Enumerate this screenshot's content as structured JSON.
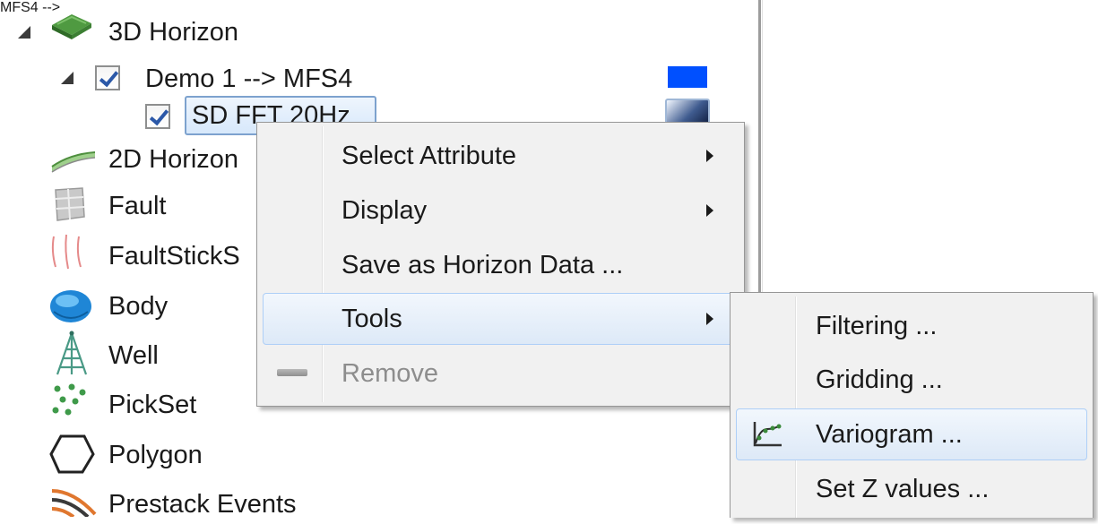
{
  "tree": {
    "items": [
      {
        "label": "3D Horizon",
        "icon": "horizon-3d-icon"
      },
      {
        "label": "Demo 1 --> MFS4",
        "checked": true,
        "swatch_color": "#0050ff"
      },
      {
        "label": "SD FFT 20Hz",
        "checked": true,
        "selected": true
      },
      {
        "label": "2D Horizon",
        "icon": "horizon-2d-icon"
      },
      {
        "label": "Fault",
        "icon": "fault-icon"
      },
      {
        "label": "FaultStickS",
        "icon": "faultstick-icon"
      },
      {
        "label": "Body",
        "icon": "body-icon"
      },
      {
        "label": "Well",
        "icon": "well-icon"
      },
      {
        "label": "PickSet",
        "icon": "pickset-icon"
      },
      {
        "label": "Polygon",
        "icon": "polygon-icon"
      },
      {
        "label": "Prestack Events",
        "icon": "prestack-events-icon"
      }
    ]
  },
  "context_menu": {
    "items": [
      {
        "label": "Select Attribute",
        "submenu": true
      },
      {
        "label": "Display",
        "submenu": true
      },
      {
        "label": "Save as Horizon Data ...",
        "submenu": false
      },
      {
        "label": "Tools",
        "submenu": true,
        "highlighted": true
      },
      {
        "label": "Remove",
        "submenu": false,
        "disabled": true,
        "icon": "remove-icon"
      }
    ]
  },
  "tools_submenu": {
    "items": [
      {
        "label": "Filtering ..."
      },
      {
        "label": "Gridding ..."
      },
      {
        "label": "Variogram ...",
        "highlighted": true,
        "icon": "variogram-icon"
      },
      {
        "label": "Set Z values ..."
      }
    ]
  }
}
